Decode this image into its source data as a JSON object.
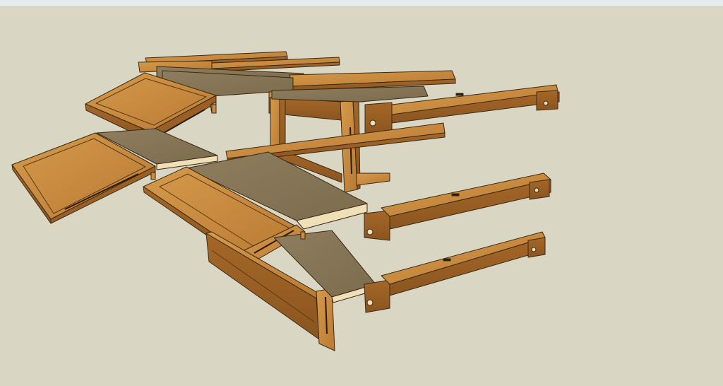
{
  "app": {
    "viewport_label": ""
  },
  "colors": {
    "background": "#dad6c4",
    "wood_top": "#c98d3f",
    "wood_side": "#a8692a",
    "wood_dark": "#7d4b1c",
    "panel_top": "#8a7a5c",
    "panel_light": "#efe0b8",
    "edge": "#3a2a14"
  },
  "scene": {
    "subject": "",
    "components": [
      {
        "name": "rear-apron-rail"
      },
      {
        "name": "upper-leg-assembly"
      },
      {
        "name": "upper-foot-rail"
      },
      {
        "name": "left-folding-leaf-upper"
      },
      {
        "name": "left-folding-leaf-lower"
      },
      {
        "name": "middle-foot-rail"
      },
      {
        "name": "center-table-panel"
      },
      {
        "name": "front-folding-leaf"
      },
      {
        "name": "front-apron"
      },
      {
        "name": "lower-foot-rail"
      }
    ]
  }
}
